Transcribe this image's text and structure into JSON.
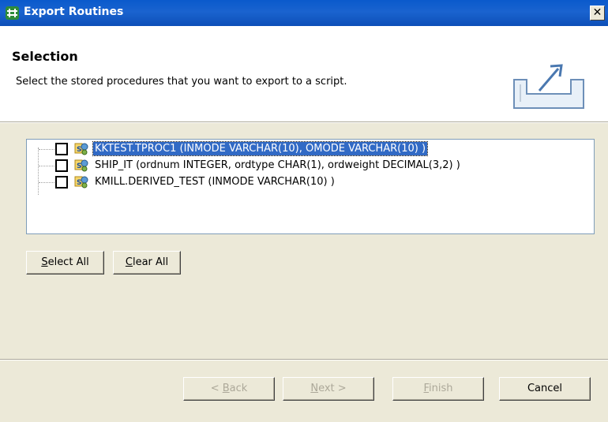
{
  "window": {
    "title": "Export Routines",
    "close_glyph": "✕"
  },
  "header": {
    "title": "Selection",
    "description": "Select the stored procedures that you want to export to a script."
  },
  "procedures": [
    {
      "label": "KKTEST.TPROC1 (INMODE VARCHAR(10), OMODE VARCHAR(10) )",
      "checked": false,
      "selected": true
    },
    {
      "label": "SHIP_IT (ordnum INTEGER, ordtype CHAR(1), ordweight DECIMAL(3,2) )",
      "checked": false,
      "selected": false
    },
    {
      "label": "KMILL.DERIVED_TEST (INMODE VARCHAR(10) )",
      "checked": false,
      "selected": false
    }
  ],
  "buttons": {
    "select_all": {
      "mnemonic": "S",
      "rest": "elect All"
    },
    "clear_all": {
      "mnemonic": "C",
      "rest": "lear All"
    },
    "back": {
      "prefix": "< ",
      "mnemonic": "B",
      "rest": "ack"
    },
    "next": {
      "mnemonic": "N",
      "rest": "ext >"
    },
    "finish": {
      "mnemonic": "F",
      "rest": "inish"
    },
    "cancel": "Cancel"
  },
  "colors": {
    "titlebar": "#0a5acc",
    "selection": "#316ac5",
    "dialog_bg": "#ece9d8"
  },
  "icons": [
    "export-routines-app-icon",
    "close-icon",
    "export-wizard-icon",
    "stored-procedure-icon"
  ]
}
